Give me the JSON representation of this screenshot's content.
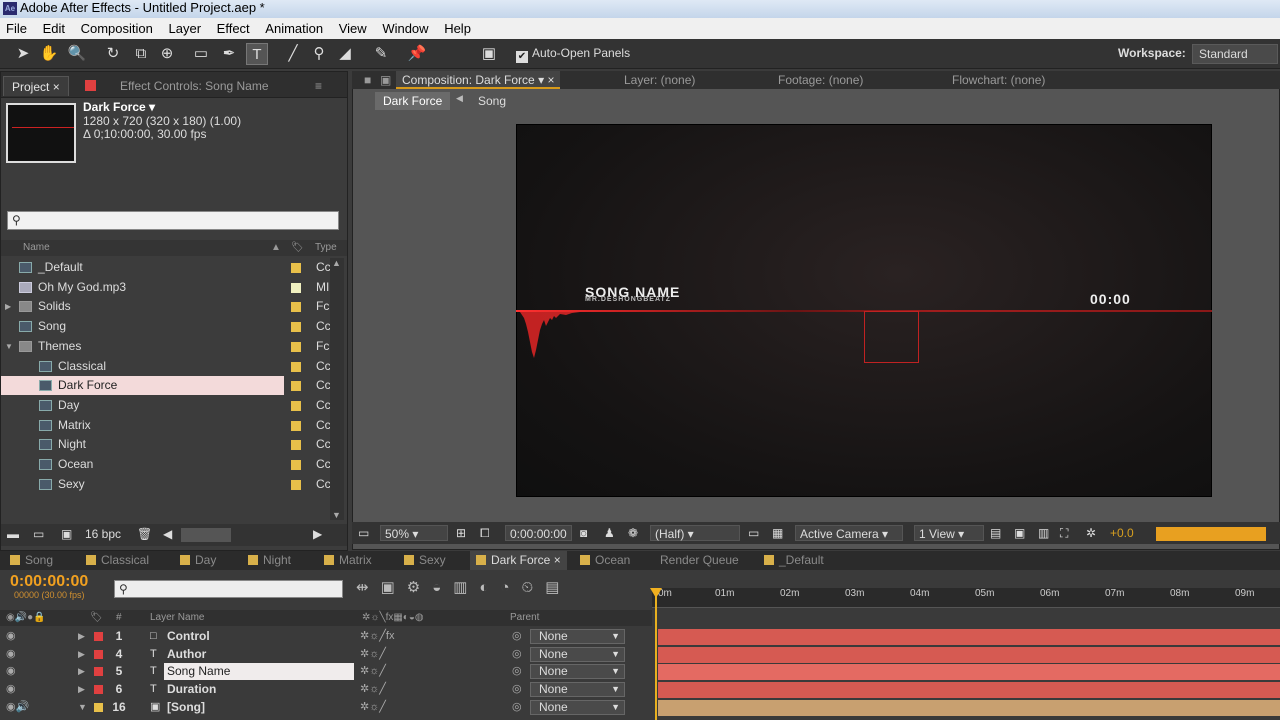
{
  "window": {
    "title": "Adobe After Effects - Untitled Project.aep *",
    "app_icon": "Ae"
  },
  "menu": [
    "File",
    "Edit",
    "Composition",
    "Layer",
    "Effect",
    "Animation",
    "View",
    "Window",
    "Help"
  ],
  "toolbar": {
    "auto_open": "Auto-Open Panels",
    "workspace_label": "Workspace:",
    "workspace_value": "Standard"
  },
  "project": {
    "tab_project": "Project",
    "tab_effect": "Effect Controls: Song Name",
    "comp_name": "Dark Force ▾",
    "comp_info1": "1280 x 720  (320 x 180) (1.00)",
    "comp_info2": "Δ 0;10:00:00, 30.00 fps",
    "search_placeholder": "",
    "col_name": "Name",
    "col_type": "Type",
    "items": [
      {
        "name": "_Default",
        "type": "Cc",
        "icon": "comp-icon",
        "color": "#e8c04a"
      },
      {
        "name": "Oh My God.mp3",
        "type": "MI",
        "icon": "audio-icon",
        "color": "#f0f0c0"
      },
      {
        "name": "Solids",
        "type": "Fc",
        "icon": "folder-icon",
        "color": "#e8c04a"
      },
      {
        "name": "Song",
        "type": "Cc",
        "icon": "comp-icon",
        "color": "#e8c04a"
      },
      {
        "name": "Themes",
        "type": "Fc",
        "icon": "folder-icon",
        "color": "#e8c04a"
      },
      {
        "name": "Classical",
        "type": "Cc",
        "icon": "comp-icon",
        "color": "#e8c04a"
      },
      {
        "name": "Dark Force",
        "type": "Cc",
        "icon": "comp-icon",
        "color": "#e8c04a"
      },
      {
        "name": "Day",
        "type": "Cc",
        "icon": "comp-icon",
        "color": "#e8c04a"
      },
      {
        "name": "Matrix",
        "type": "Cc",
        "icon": "comp-icon",
        "color": "#e8c04a"
      },
      {
        "name": "Night",
        "type": "Cc",
        "icon": "comp-icon",
        "color": "#e8c04a"
      },
      {
        "name": "Ocean",
        "type": "Cc",
        "icon": "comp-icon",
        "color": "#e8c04a"
      },
      {
        "name": "Sexy",
        "type": "Cc",
        "icon": "comp-icon",
        "color": "#e8c04a"
      }
    ],
    "bpc": "16 bpc"
  },
  "comp": {
    "tab": "Composition: Dark Force",
    "tab_layer": "Layer: (none)",
    "tab_footage": "Footage: (none)",
    "tab_flow": "Flowchart: (none)",
    "crumb1": "Dark Force",
    "crumb2": "Song",
    "song_name": "SONG NAME",
    "author": "MR.DESHONGBEATZ",
    "time_display": "00:00",
    "zoom": "50%",
    "timecode": "0:00:00:00",
    "resolution": "(Half)",
    "camera": "Active Camera",
    "view": "1 View",
    "exposure": "+0.0"
  },
  "timeline": {
    "tabs": [
      "Song",
      "Classical",
      "Day",
      "Night",
      "Matrix",
      "Sexy",
      "Dark Force",
      "Ocean",
      "Render Queue",
      "_Default"
    ],
    "active_tab": "Dark Force",
    "time": "0:00:00:00",
    "fps": "00000 (30.00 fps)",
    "col_layer": "Layer Name",
    "col_parent": "Parent",
    "ruler": [
      "0m",
      "01m",
      "02m",
      "03m",
      "04m",
      "05m",
      "06m",
      "07m",
      "08m",
      "09m"
    ],
    "layers": [
      {
        "num": "1",
        "name": "Control",
        "parent": "None"
      },
      {
        "num": "4",
        "name": "Author",
        "parent": "None"
      },
      {
        "num": "5",
        "name": "Song Name",
        "parent": "None"
      },
      {
        "num": "6",
        "name": "Duration",
        "parent": "None"
      },
      {
        "num": "16",
        "name": "[Song]",
        "parent": "None"
      }
    ]
  }
}
